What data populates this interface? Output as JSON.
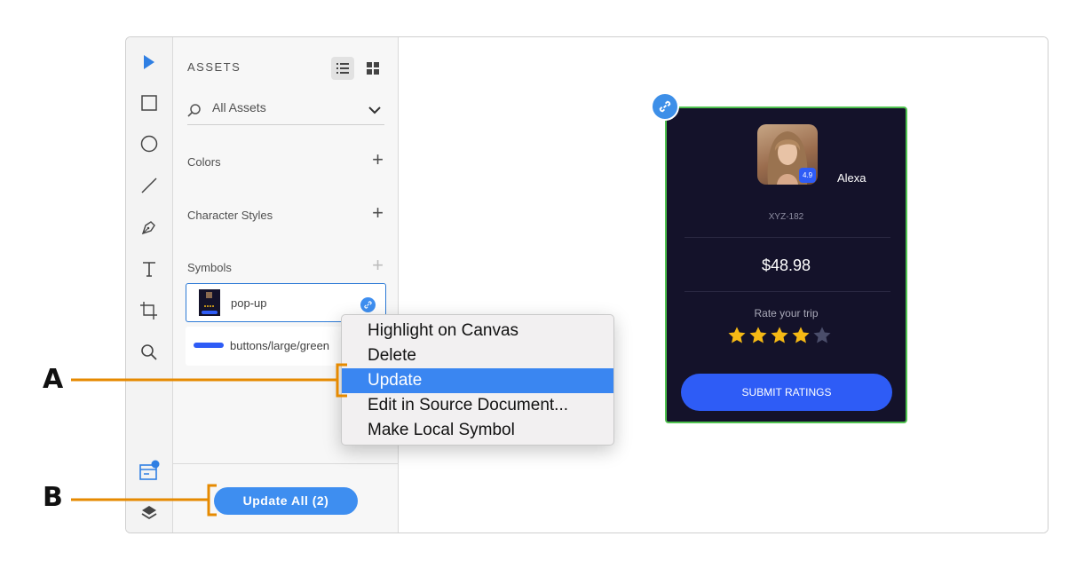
{
  "assets_panel": {
    "title": "ASSETS",
    "search_value": "All Assets",
    "sections": {
      "colors": "Colors",
      "character_styles": "Character Styles",
      "symbols": "Symbols"
    },
    "symbols": [
      {
        "label": "pop-up",
        "selected": true
      },
      {
        "label": "buttons/large/green",
        "selected": false
      }
    ],
    "update_all_label": "Update All (2)"
  },
  "toolbar": {
    "tools": [
      "select-tool-icon",
      "rectangle-tool-icon",
      "ellipse-tool-icon",
      "line-tool-icon",
      "pen-tool-icon",
      "text-tool-icon",
      "artboard-tool-icon",
      "zoom-tool-icon"
    ],
    "bottom": [
      "assets-panel-icon",
      "layers-panel-icon"
    ]
  },
  "context_menu": {
    "items": [
      {
        "label": "Highlight on Canvas"
      },
      {
        "label": "Delete"
      },
      {
        "label": "Update",
        "highlighted": true
      },
      {
        "label": "Edit in Source Document..."
      },
      {
        "label": "Make Local Symbol"
      }
    ]
  },
  "card": {
    "avatar_rating": "4.9",
    "name": "Alexa",
    "code": "XYZ-182",
    "price": "$48.98",
    "rate_prompt": "Rate your trip",
    "rating": 4,
    "rating_max": 5,
    "submit_label": "SUBMIT RATINGS"
  },
  "annotations": {
    "a": "A",
    "b": "B"
  },
  "colors": {
    "accent_blue": "#3e8ef0",
    "menu_highlight": "#3a86f1",
    "card_bg": "#14122a",
    "card_border": "#4fc24f",
    "submit_blue": "#2e5cf6",
    "star_gold": "#f5b915",
    "callout_orange": "#e68a00"
  }
}
